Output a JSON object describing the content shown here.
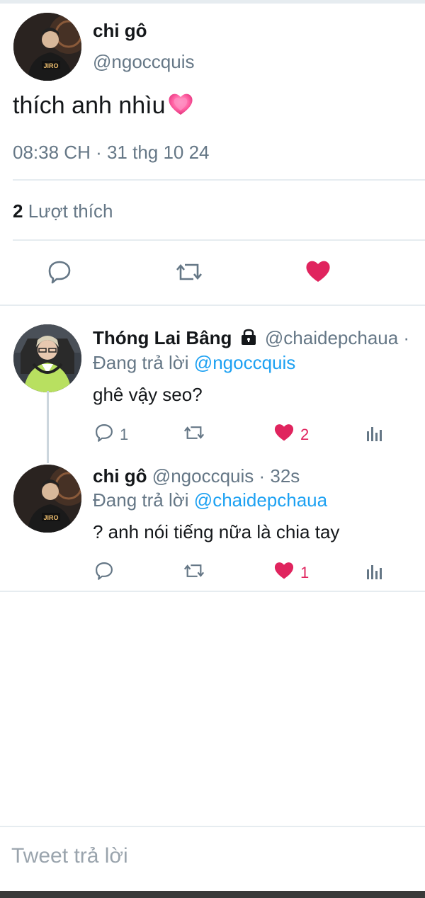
{
  "tweet": {
    "author_name": "chi gô",
    "author_handle": "@ngoccquis",
    "text": "thích anh nhìu",
    "emoji": "growing-heart-emoji",
    "timestamp": "08:38 CH · 31 thg 10 24",
    "likes_count": "2",
    "likes_label": "Lượt thích",
    "liked": true
  },
  "replies": [
    {
      "name": "Thóng Lai Bâng",
      "handle": "@chaidepchaua ·",
      "locked": true,
      "replying_prefix": "Đang trả lời",
      "replying_to": "@ngoccquis",
      "text": "ghê vậy seo?",
      "reply_count": "1",
      "like_count": "2",
      "liked": true
    },
    {
      "name": "chi gô",
      "handle": "@ngoccquis · 32s",
      "locked": false,
      "replying_prefix": "Đang trả lời",
      "replying_to": "@chaidepchaua",
      "text": "? anh nói tiếng nữa là chia tay",
      "reply_count": "",
      "like_count": "1",
      "liked": true
    }
  ],
  "compose": {
    "placeholder": "Tweet trả lời"
  },
  "colors": {
    "accent": "#1da1f2",
    "like": "#e0245e",
    "muted": "#657786",
    "divider": "#e6ecf0"
  },
  "icons": [
    "reply-icon",
    "retweet-icon",
    "heart-icon",
    "analytics-icon",
    "lock-icon"
  ]
}
